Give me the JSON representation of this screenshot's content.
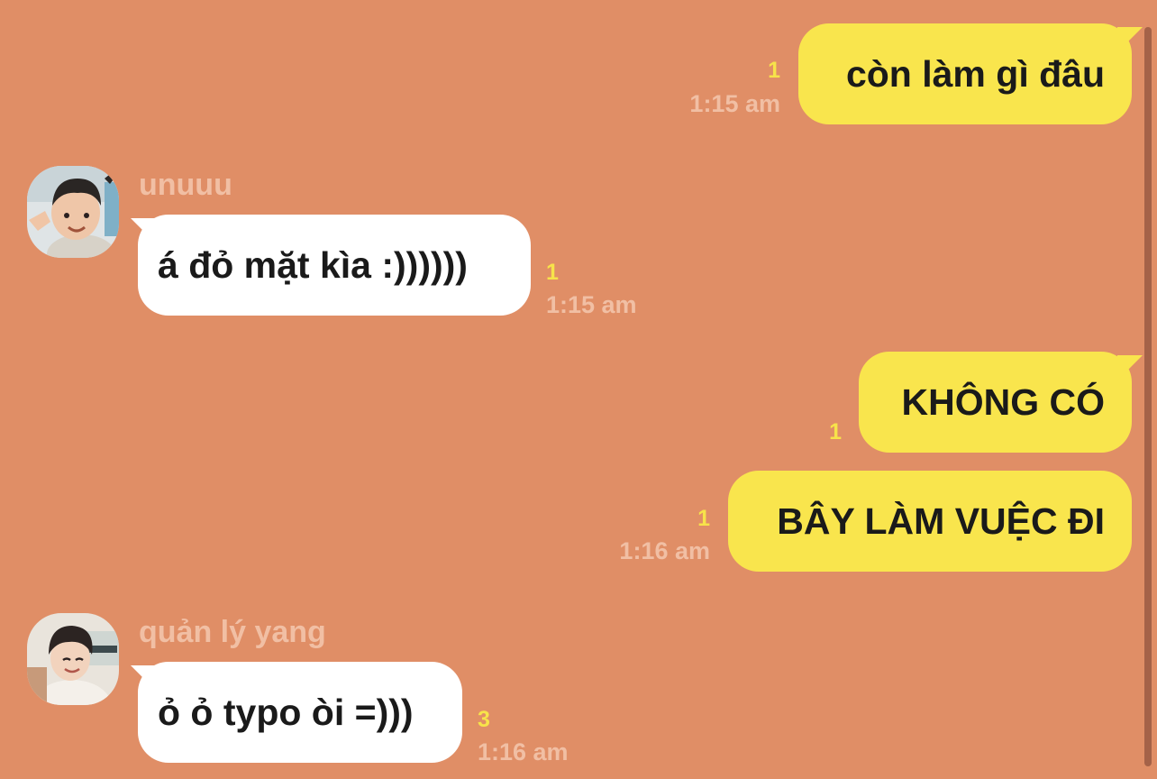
{
  "colors": {
    "background": "#e08e66",
    "outgoing_bubble": "#f9e54d",
    "incoming_bubble": "#ffffff",
    "unread_count": "#f7e34a",
    "meta_text": "#f1bfa4"
  },
  "messages": [
    {
      "direction": "out",
      "text": "còn làm gì đâu",
      "unread": "1",
      "time": "1:15 am"
    },
    {
      "direction": "in",
      "sender": "unuuu",
      "avatar": "child-photo-avatar",
      "text": "á đỏ mặt kìa :))))))",
      "unread": "1",
      "time": "1:15 am"
    },
    {
      "direction": "out",
      "text": "KHÔNG CÓ",
      "unread": "1",
      "time": ""
    },
    {
      "direction": "out",
      "text": "BÂY LÀM VUỆC ĐI",
      "unread": "1",
      "time": "1:16 am"
    },
    {
      "direction": "in",
      "sender": "quản lý yang",
      "avatar": "man-photo-avatar",
      "text": "ỏ ỏ typo òi =)))",
      "unread": "3",
      "time": "1:16 am"
    }
  ]
}
